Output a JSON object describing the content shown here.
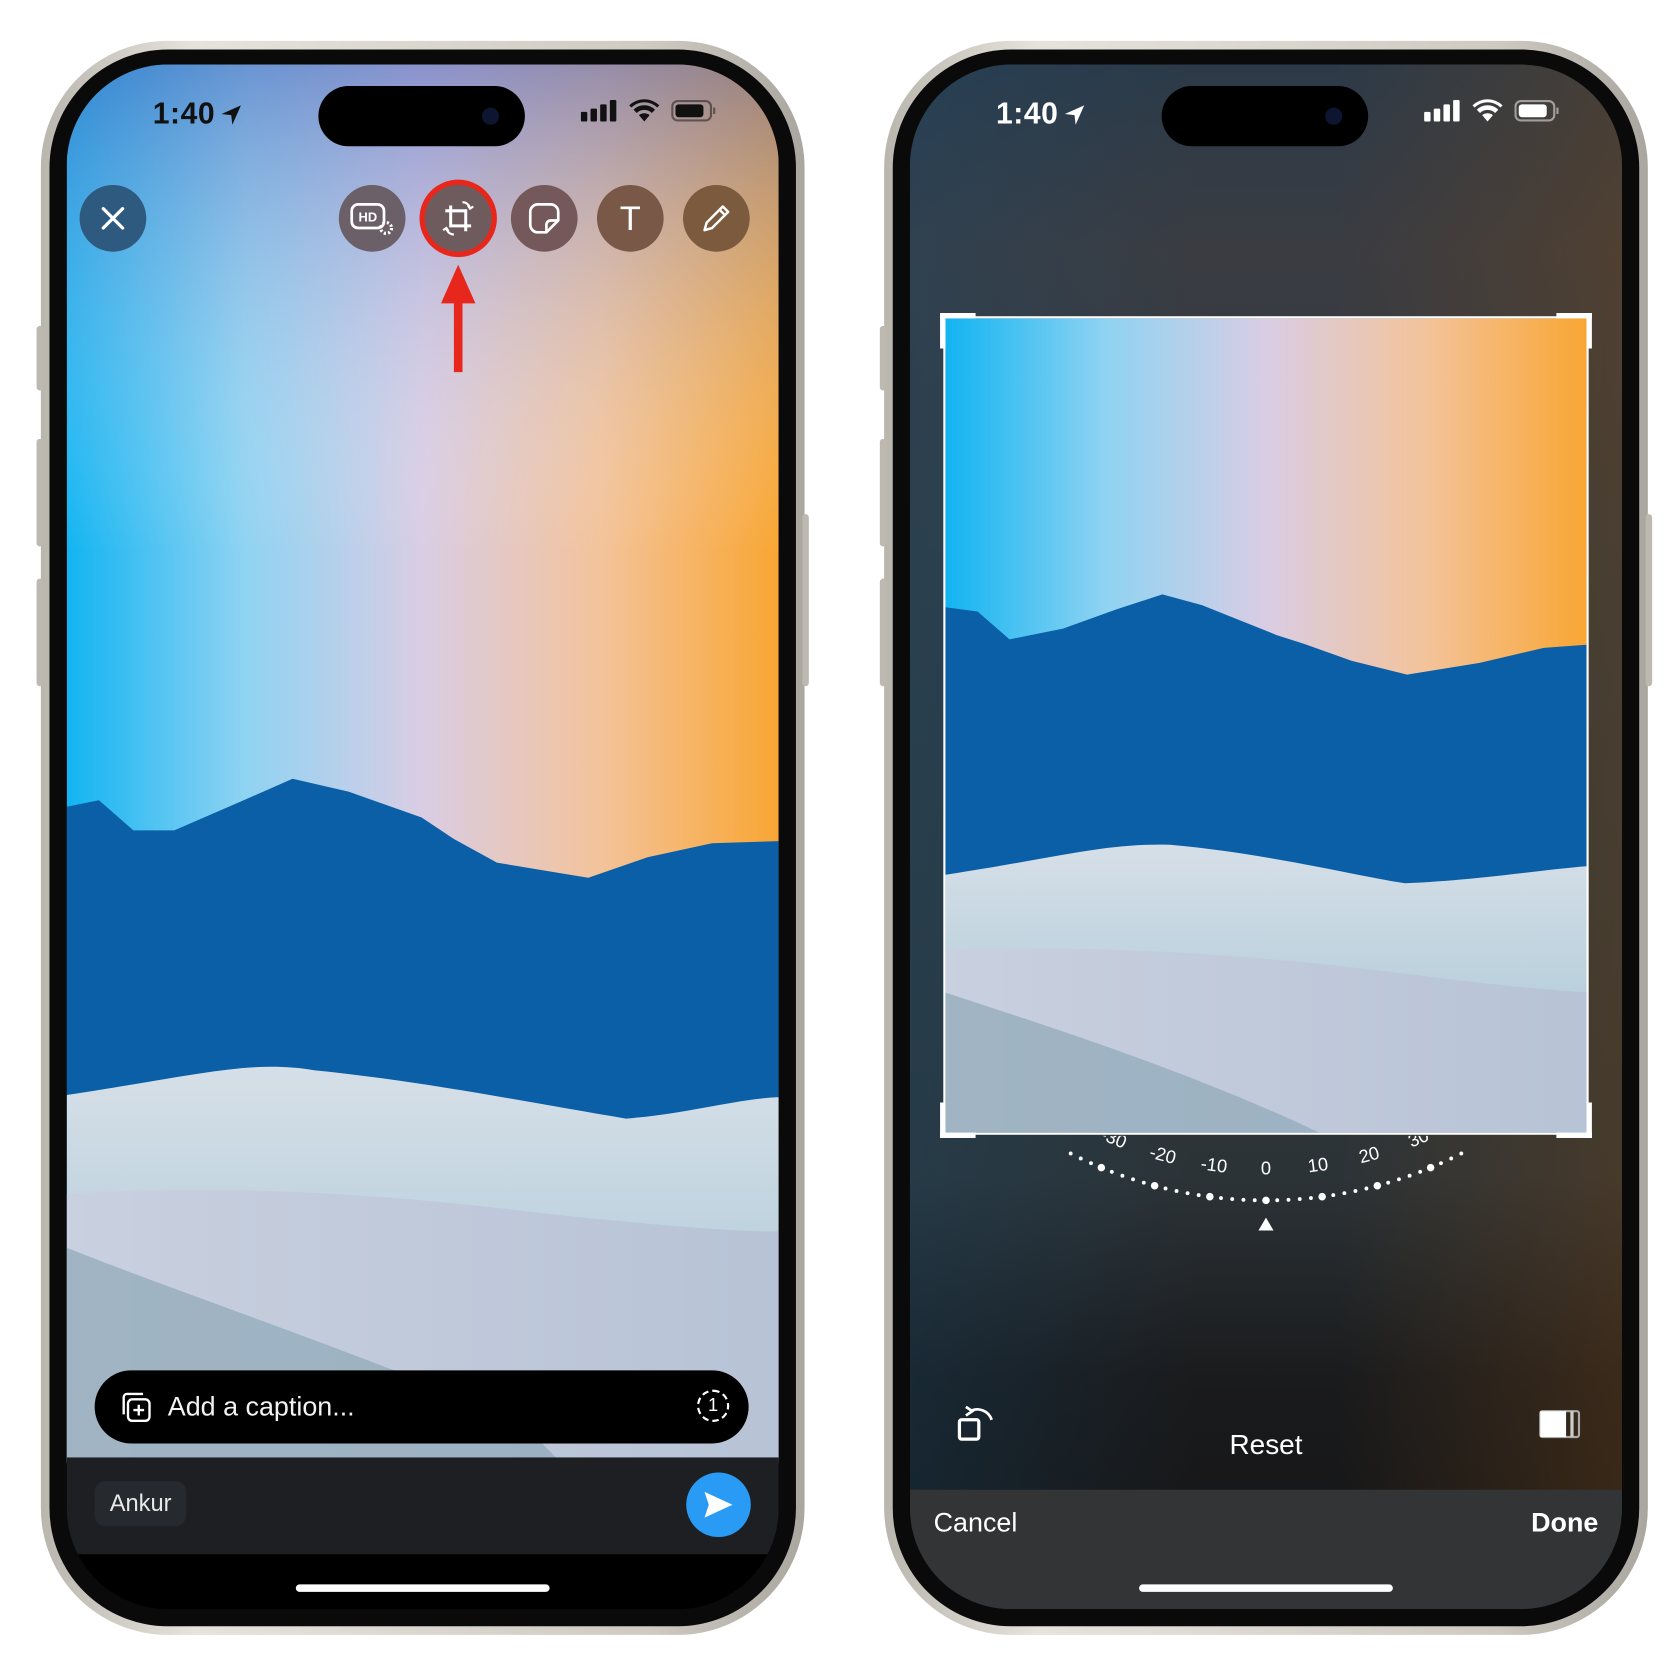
{
  "left_phone": {
    "status": {
      "time": "1:40"
    },
    "toolbar": {
      "close_icon": "close-icon",
      "tools": [
        {
          "icon": "hd-settings-icon",
          "label": "HD"
        },
        {
          "icon": "crop-rotate-icon",
          "highlighted": true
        },
        {
          "icon": "sticker-icon"
        },
        {
          "icon": "text-icon",
          "label": "T"
        },
        {
          "icon": "pencil-icon"
        }
      ]
    },
    "annotation": {
      "color": "#e8271c",
      "type": "arrow-pointing-to-crop"
    },
    "caption": {
      "placeholder": "Add a caption...",
      "view_once_label": "1"
    },
    "recipient": "Ankur",
    "send_color": "#2a9bf5"
  },
  "right_phone": {
    "status": {
      "time": "1:40"
    },
    "dial": {
      "ticks": [
        "-30",
        "-20",
        "-10",
        "0",
        "10",
        "20",
        "30"
      ],
      "value": 0
    },
    "reset_label": "Reset",
    "cancel_label": "Cancel",
    "done_label": "Done"
  }
}
